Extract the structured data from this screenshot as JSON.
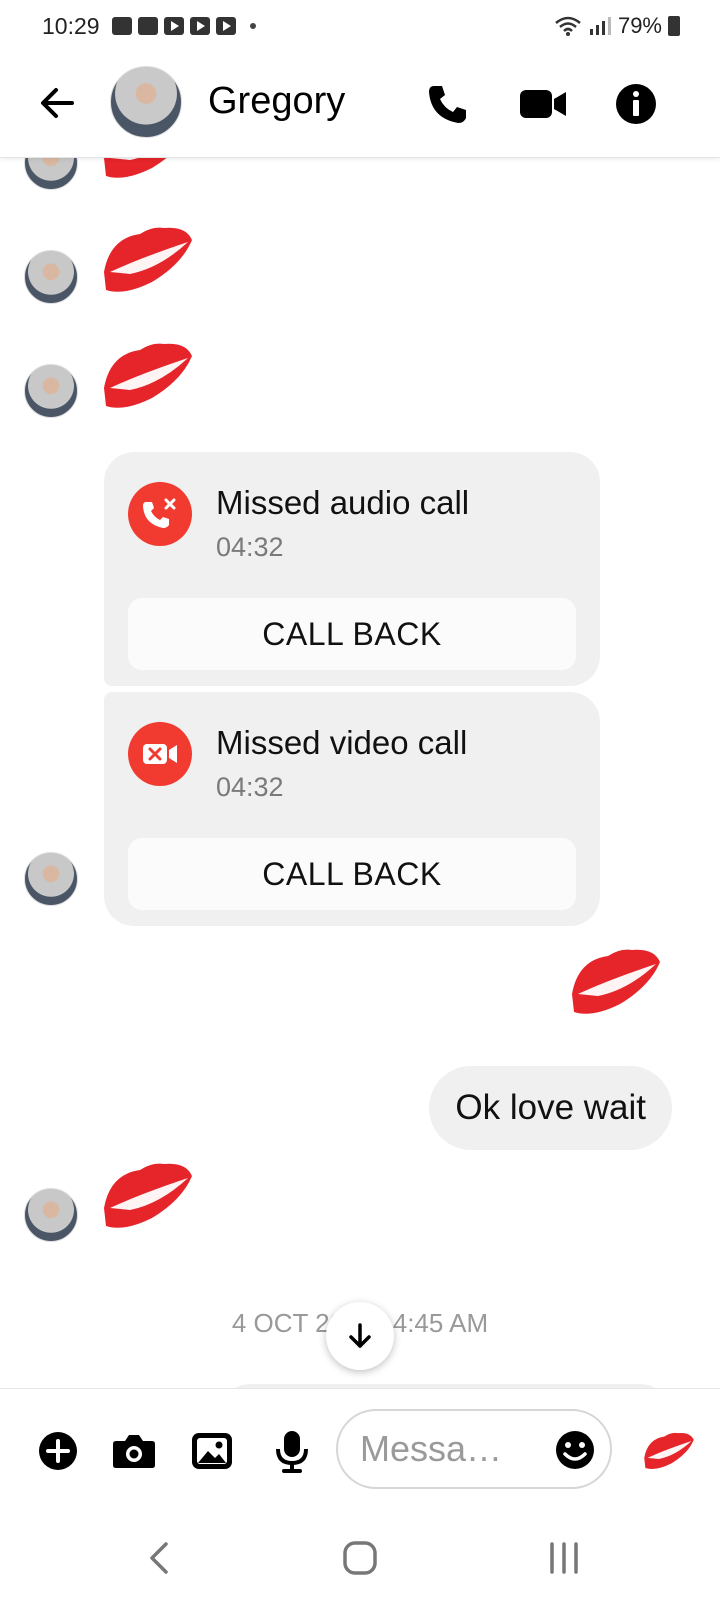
{
  "status_bar": {
    "time": "10:29",
    "battery": "79%",
    "notification_icons": [
      "shopping-bag-icon",
      "folder-icon",
      "youtube-icon",
      "youtube-icon",
      "youtube-icon"
    ]
  },
  "header": {
    "contact_name": "Gregory",
    "actions": [
      "back-icon",
      "phone-icon",
      "video-icon",
      "info-icon"
    ]
  },
  "messages": {
    "missed_audio": {
      "title": "Missed audio call",
      "time": "04:32",
      "action": "CALL BACK"
    },
    "missed_video": {
      "title": "Missed video call",
      "time": "04:32",
      "action": "CALL BACK"
    },
    "outgoing_text": "Ok love wait",
    "date_separator": "4 OCT 20’ AT 4:45 AM"
  },
  "composer": {
    "placeholder": "Messa…",
    "quick_reaction": "kiss-mark"
  },
  "colors": {
    "missed_call_red": "#f23b30",
    "bubble_gray": "#f0f0f0",
    "kiss_red": "#e5252a"
  }
}
